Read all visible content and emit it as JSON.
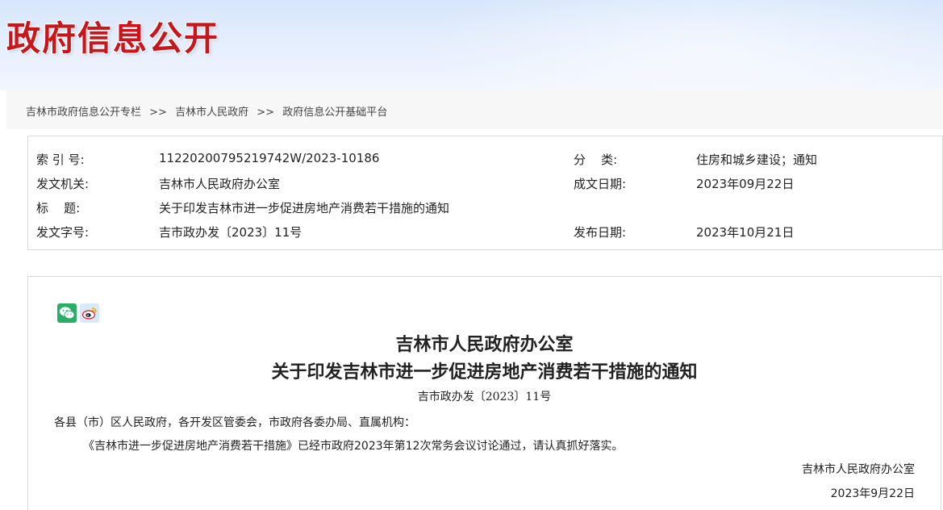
{
  "banner": {
    "title": "政府信息公开"
  },
  "breadcrumb": {
    "items": [
      "吉林市政府信息公开专栏",
      "吉林市人民政府",
      "政府信息公开基础平台"
    ],
    "separator": ">>"
  },
  "meta": {
    "index_label": "索 引 号:",
    "index_value": "11220200795219742W/2023-10186",
    "category_label": "分    类:",
    "category_value": "住房和城乡建设；通知",
    "issuer_label": "发文机关:",
    "issuer_value": "吉林市人民政府办公室",
    "written_date_label": "成文日期:",
    "written_date_value": "2023年09月22日",
    "title_label": "标    题:",
    "title_value": "关于印发吉林市进一步促进房地产消费若干措施的通知",
    "doc_no_label": "发文字号:",
    "doc_no_value": "吉市政办发〔2023〕11号",
    "publish_date_label": "发布日期:",
    "publish_date_value": "2023年10月21日"
  },
  "share": {
    "icons": [
      "wechat-icon",
      "weibo-icon"
    ]
  },
  "document": {
    "title_line1": "吉林市人民政府办公室",
    "title_line2": "关于印发吉林市进一步促进房地产消费若干措施的通知",
    "doc_number": "吉市政办发〔2023〕11号",
    "salutation": "各县（市）区人民政府，各开发区管委会，市政府各委办局、直属机构：",
    "body": "《吉林市进一步促进房地产消费若干措施》已经市政府2023年第12次常务会议讨论通过，请认真抓好落实。",
    "signature": "吉林市人民政府办公室",
    "date": "2023年9月22日"
  },
  "colors": {
    "banner_title": "#c8161d",
    "wechat": "#2aae67",
    "weibo": "#e6162d"
  }
}
